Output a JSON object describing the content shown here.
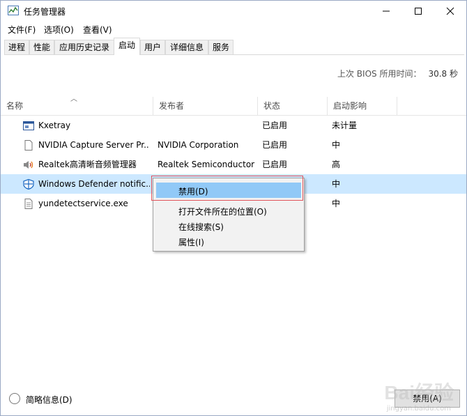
{
  "window": {
    "title": "任务管理器"
  },
  "menu": [
    "文件(F)",
    "选项(O)",
    "查看(V)"
  ],
  "tabs": [
    "进程",
    "性能",
    "应用历史记录",
    "启动",
    "用户",
    "详细信息",
    "服务"
  ],
  "active_tab": "启动",
  "bios": {
    "label": "上次 BIOS 所用时间：",
    "value": "30.8 秒"
  },
  "columns": [
    "名称",
    "发布者",
    "状态",
    "启动影响"
  ],
  "rows": [
    {
      "icon": "window-icon",
      "name": "Kxetray",
      "publisher": "",
      "status": "已启用",
      "impact": "未计量"
    },
    {
      "icon": "document-icon",
      "name": "NVIDIA Capture Server Pr...",
      "publisher": "NVIDIA Corporation",
      "status": "已启用",
      "impact": "中"
    },
    {
      "icon": "speaker-icon",
      "name": "Realtek高清晰音频管理器",
      "publisher": "Realtek Semiconductor",
      "status": "已启用",
      "impact": "高"
    },
    {
      "icon": "defender-shield-icon",
      "name": "Windows Defender notific...",
      "publisher": "",
      "status": "",
      "impact": "中"
    },
    {
      "icon": "document-icon",
      "name": "yundetectservice.exe",
      "publisher": "",
      "status": "",
      "impact": "中"
    }
  ],
  "context_menu": [
    "禁用(D)",
    "打开文件所在的位置(O)",
    "在线搜索(S)",
    "属性(I)"
  ],
  "footer": {
    "brief_label": "简略信息(D)",
    "disable_button": "禁用(A)"
  },
  "watermark": {
    "main": "Bai经验",
    "sub": "jingyan.baidu.com"
  },
  "colors": {
    "selection": "#cce8ff",
    "menu_highlight": "#91c9f7",
    "annotation": "#e0525a"
  }
}
